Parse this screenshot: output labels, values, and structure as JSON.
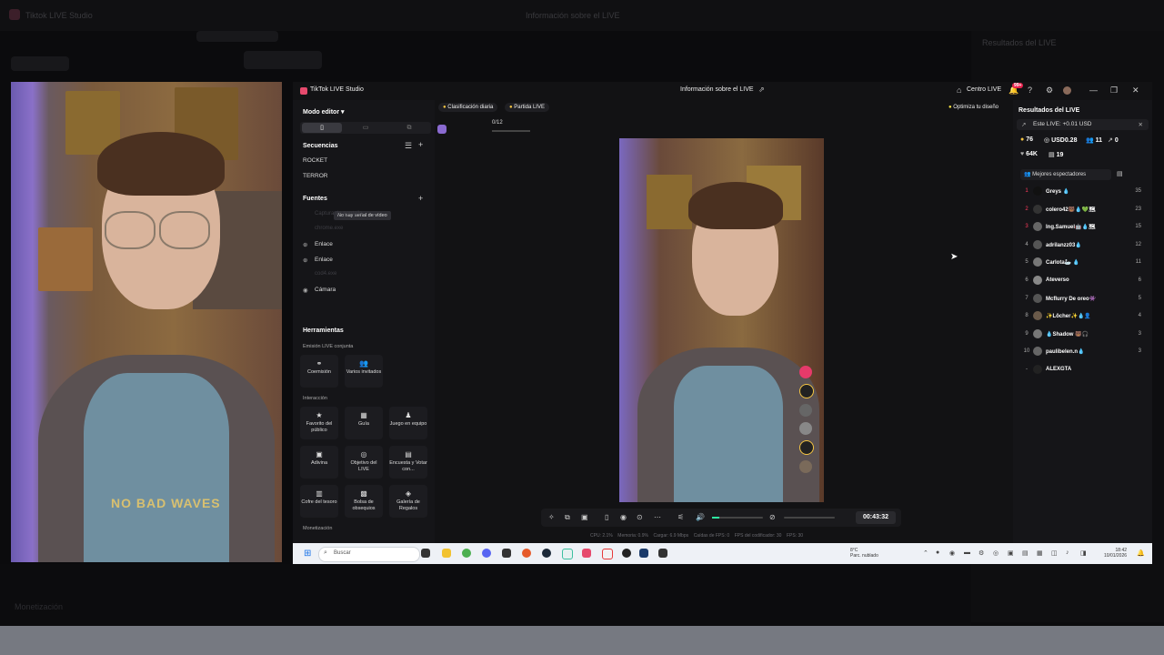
{
  "background": {
    "app_title": "Tiktok LIVE Studio",
    "window_title": "Información sobre el LIVE",
    "right_title": "Resultados del LIVE",
    "bottom_label": "Monetización"
  },
  "titlebar": {
    "app_name": "TikTok LIVE Studio",
    "center_title": "Información sobre el LIVE",
    "live_center": "Centro LIVE",
    "notification_badge": "99+"
  },
  "left_panel": {
    "mode_editor": "Modo editor",
    "sequences_title": "Secuencias",
    "sequences": [
      "ROCKET",
      "TERROR"
    ],
    "sources_title": "Fuentes",
    "tooltip": "No hay señal de vídeo",
    "sources_hidden": [
      "Captura de pantalla",
      "chrome.exe",
      "cod4.exe"
    ],
    "sources": [
      "Enlace",
      "Enlace",
      "Cámara"
    ],
    "tools_title": "Herramientas",
    "joint_title": "Emisión LIVE conjunta",
    "joint_tools": [
      "Coemisión",
      "Varios invitados"
    ],
    "interaction_title": "Interacción",
    "interaction_tools": [
      "Favorito del público",
      "Guía",
      "Juego en equipo",
      "Adivina",
      "Objetivo del LIVE",
      "Encuesta y Votar con...",
      "Cofre del tesoro",
      "Bolsa de obsequios",
      "Galería de Regalos"
    ],
    "monetization_title": "Monetización"
  },
  "center": {
    "chip_daily": "Clasificación diaria",
    "chip_match": "Partida LIVE",
    "optimize": "Optimiza tu diseño",
    "viewer_progress": "0/12",
    "timer": "00:43:32",
    "stats": [
      "CPU: 2.1%",
      "Memoria: 0.9%",
      "Cargar: 6.9 Mbps",
      "Caídas de FPS: 0",
      "FPS del codificador: 30",
      "FPS: 30"
    ],
    "shirt_text": "NO BAD WAVES"
  },
  "right_panel": {
    "title": "Resultados del LIVE",
    "this_live": "Este LIVE: +0.01 USD",
    "stats": {
      "coins": "76",
      "usd": "USD0.28",
      "viewers": "11",
      "shares": "0",
      "likes": "64K",
      "gifts": "19"
    },
    "best_viewers": "Mejores espectadores",
    "ranking": [
      {
        "rank": "1",
        "name": "Greys 💧",
        "count": "35"
      },
      {
        "rank": "2",
        "name": "colero42🐻💧💚🗺",
        "count": "23"
      },
      {
        "rank": "3",
        "name": "Ing.Samuel🤖💧🗺",
        "count": "15"
      },
      {
        "rank": "4",
        "name": "adrilanzz03💧",
        "count": "12"
      },
      {
        "rank": "5",
        "name": "Carlota🦢 💧",
        "count": "11"
      },
      {
        "rank": "6",
        "name": "Ateverso",
        "count": "6"
      },
      {
        "rank": "7",
        "name": "Mcflurry De oreo👾",
        "count": "5"
      },
      {
        "rank": "8",
        "name": "✨Löcher✨💧👤",
        "count": "4"
      },
      {
        "rank": "9",
        "name": "💧Shadow 🐻🎧",
        "count": "3"
      },
      {
        "rank": "10",
        "name": "paulibelen.n💧",
        "count": "3"
      },
      {
        "rank": "-",
        "name": "ALEXGTA",
        "count": ""
      }
    ]
  },
  "taskbar": {
    "search": "Buscar",
    "weather_temp": "8°C",
    "weather_desc": "Parc. nublado",
    "time": "18:42",
    "date": "10/01/2026"
  }
}
